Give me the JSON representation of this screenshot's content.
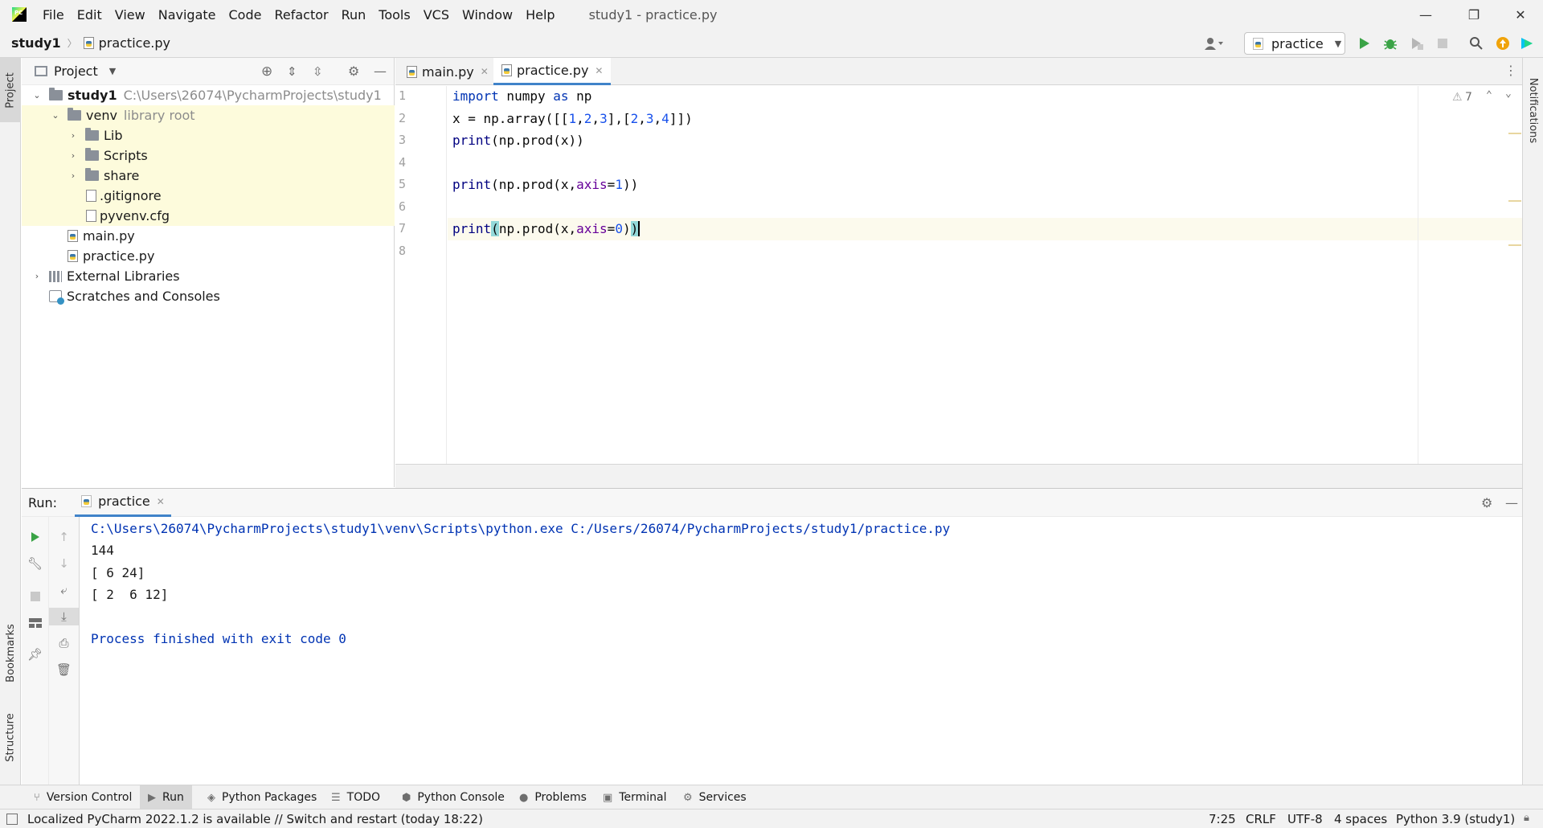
{
  "menubar": {
    "items": [
      "File",
      "Edit",
      "View",
      "Navigate",
      "Code",
      "Refactor",
      "Run",
      "Tools",
      "VCS",
      "Window",
      "Help"
    ],
    "window_title": "study1 - practice.py",
    "minimize": "—",
    "restore": "❐",
    "close": "✕"
  },
  "navbar": {
    "project": "study1",
    "file": "practice.py",
    "run_config": "practice"
  },
  "left_strip": {
    "project_tab": "Project",
    "bookmarks_tab": "Bookmarks",
    "structure_tab": "Structure"
  },
  "right_strip": {
    "notifications_tab": "Notifications"
  },
  "project_pane": {
    "title": "Project",
    "tree": [
      {
        "label": "study1",
        "hint": "C:\\Users\\26074\\PycharmProjects\\study1"
      },
      {
        "label": "venv",
        "hint": "library root"
      },
      {
        "label": "Lib"
      },
      {
        "label": "Scripts"
      },
      {
        "label": "share"
      },
      {
        "label": ".gitignore"
      },
      {
        "label": "pyvenv.cfg"
      },
      {
        "label": "main.py"
      },
      {
        "label": "practice.py"
      },
      {
        "label": "External Libraries"
      },
      {
        "label": "Scratches and Consoles"
      }
    ]
  },
  "editor": {
    "tabs": [
      "main.py",
      "practice.py"
    ],
    "active_tab": "practice.py",
    "line_numbers": [
      "1",
      "2",
      "3",
      "4",
      "5",
      "6",
      "7",
      "8"
    ],
    "code": [
      "import numpy as np",
      "x = np.array([[1,2,3],[2,3,4]])",
      "print(np.prod(x))",
      "",
      "print(np.prod(x,axis=1))",
      "",
      "print(np.prod(x,axis=0))",
      ""
    ],
    "warnings_count": "7"
  },
  "run_panel": {
    "label": "Run:",
    "tab": "practice",
    "output": [
      "C:\\Users\\26074\\PycharmProjects\\study1\\venv\\Scripts\\python.exe C:/Users/26074/PycharmProjects/study1/practice.py",
      "144",
      "[ 6 24]",
      "[ 2  6 12]",
      "",
      "Process finished with exit code 0"
    ]
  },
  "bottom_tabs": [
    "Version Control",
    "Run",
    "Python Packages",
    "TODO",
    "Python Console",
    "Problems",
    "Terminal",
    "Services"
  ],
  "status_bar": {
    "message": "Localized PyCharm 2022.1.2 is available // Switch and restart (today 18:22)",
    "position": "7:25",
    "line_sep": "CRLF",
    "encoding": "UTF-8",
    "indent": "4 spaces",
    "interpreter": "Python 3.9 (study1)"
  },
  "colors": {
    "accent": "#4083c9",
    "keyword": "#0033b3",
    "number": "#1750eb",
    "param": "#660099",
    "run_green": "#3aa346",
    "highlight_yellow": "#fdfbdc"
  }
}
